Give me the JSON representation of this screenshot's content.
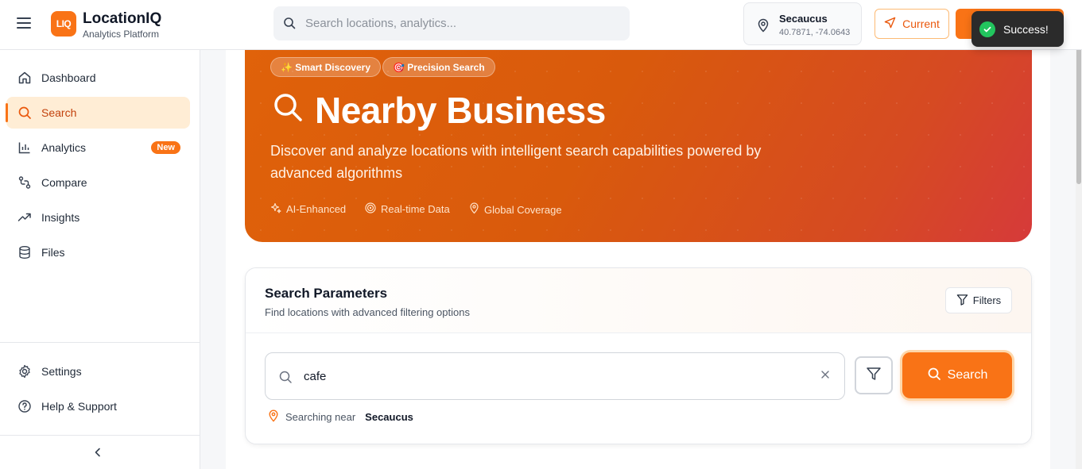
{
  "header": {
    "logo_badge": "LIQ",
    "brand_name": "LocationIQ",
    "brand_sub": "Analytics Platform",
    "search_placeholder": "Search locations, analytics...",
    "location": {
      "city": "Secaucus",
      "coords": "40.7871, -74.0643"
    },
    "current_label": "Current",
    "toast_label": "Success!"
  },
  "sidebar": {
    "items": [
      {
        "label": "Dashboard",
        "icon": "home-icon"
      },
      {
        "label": "Search",
        "icon": "search-icon",
        "active": true
      },
      {
        "label": "Analytics",
        "icon": "bar-chart-icon",
        "badge": "New"
      },
      {
        "label": "Compare",
        "icon": "compare-icon"
      },
      {
        "label": "Insights",
        "icon": "trend-icon"
      },
      {
        "label": "Files",
        "icon": "database-icon"
      }
    ],
    "footer_items": [
      {
        "label": "Settings",
        "icon": "gear-icon"
      },
      {
        "label": "Help & Support",
        "icon": "help-icon"
      }
    ]
  },
  "hero": {
    "pill_1": "✨ Smart Discovery",
    "pill_2": "🎯 Precision Search",
    "title": "Nearby Business",
    "description": "Discover and analyze locations with intelligent search capabilities powered by advanced algorithms",
    "features": [
      "AI-Enhanced",
      "Real-time Data",
      "Global Coverage"
    ]
  },
  "panel": {
    "title": "Search Parameters",
    "subtitle": "Find locations with advanced filtering options",
    "filters_label": "Filters",
    "query_value": "cafe",
    "search_label": "Search",
    "near_prefix": "Searching near",
    "near_city": "Secaucus"
  },
  "colors": {
    "accent": "#f97316",
    "active_bg": "#ffedd5",
    "toast_bg": "#2b2b2b",
    "success": "#22c55e"
  }
}
